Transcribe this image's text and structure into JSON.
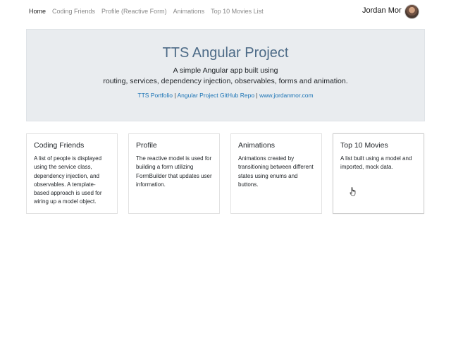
{
  "nav": {
    "links": [
      {
        "label": "Home",
        "active": true
      },
      {
        "label": "Coding Friends"
      },
      {
        "label": "Profile (Reactive Form)"
      },
      {
        "label": "Animations"
      },
      {
        "label": "Top 10 Movies List"
      }
    ],
    "user_name": "Jordan Mor"
  },
  "jumbotron": {
    "title": "TTS Angular Project",
    "lead_line1": "A simple Angular app built using",
    "lead_line2": "routing, services, dependency injection, observables, forms and animation.",
    "links": [
      {
        "label": "TTS Portfolio"
      },
      {
        "label": "Angular Project GitHub Repo"
      },
      {
        "label": "www.jordanmor.com"
      }
    ],
    "separator": "|"
  },
  "cards": [
    {
      "title": "Coding Friends",
      "text": "A list of people is displayed using the service class, dependency injection, and observables. A template-based approach is used for wiring up a model object."
    },
    {
      "title": "Profile",
      "text": "The reactive model is used for building a form utilizing FormBuilder that updates user information."
    },
    {
      "title": "Animations",
      "text": "Animations created by transitioning between different states using enums and buttons."
    },
    {
      "title": "Top 10 Movies",
      "text": "A list built using a model and imported, mock data."
    }
  ],
  "colors": {
    "jumbotron_bg": "#e9ecef",
    "title_color": "#4d6b87",
    "link_color": "#1a73b5",
    "nav_inactive": "#8a8a8a"
  }
}
